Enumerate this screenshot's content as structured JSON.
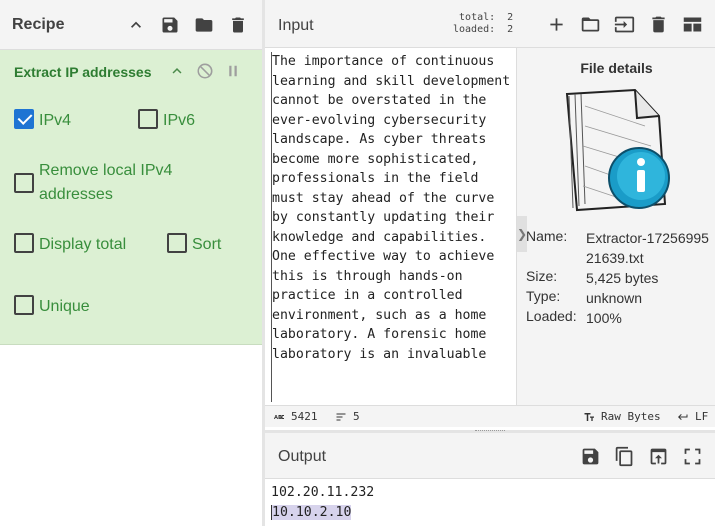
{
  "recipe": {
    "title": "Recipe",
    "operation": {
      "title": "Extract IP addresses",
      "options": {
        "ipv4": {
          "label": "IPv4",
          "checked": true
        },
        "ipv6": {
          "label": "IPv6",
          "checked": false
        },
        "remove_local": {
          "label": "Remove local IPv4 addresses",
          "checked": false
        },
        "display_total": {
          "label": "Display total",
          "checked": false
        },
        "sort": {
          "label": "Sort",
          "checked": false
        },
        "unique": {
          "label": "Unique",
          "checked": false
        }
      }
    }
  },
  "input": {
    "title": "Input",
    "counts": {
      "total_label": "total:",
      "total": "2",
      "loaded_label": "loaded:",
      "loaded": "2"
    },
    "text": "The importance of continuous learning and skill development cannot be overstated in the ever-evolving cybersecurity landscape. As cyber threats become more sophisticated, professionals in the field must stay ahead of the curve by constantly updating their knowledge and capabilities. One effective way to achieve this is through hands-on practice in a controlled environment, such as a home laboratory. A forensic home laboratory is an invaluable",
    "file_details": {
      "title": "File details",
      "toggle": "❯",
      "name_label": "Name:",
      "name": "Extractor-1725699521639.txt",
      "size_label": "Size:",
      "size": "5,425 bytes",
      "type_label": "Type:",
      "type": "unknown",
      "loaded_label": "Loaded:",
      "loaded": "100%"
    },
    "status": {
      "chars_icon": "abc-icon",
      "chars": "5421",
      "lines": "5",
      "encoding": "Raw Bytes",
      "eol": "LF"
    }
  },
  "output": {
    "title": "Output",
    "lines": [
      "102.20.11.232",
      "10.10.2.10"
    ]
  },
  "colors": {
    "operation_bg": "#dcf0d3",
    "operation_text": "#388e3c",
    "checkbox_checked": "#1e74d3",
    "header_bg": "#f4f4f4",
    "highlight": "#d7d3ec"
  }
}
